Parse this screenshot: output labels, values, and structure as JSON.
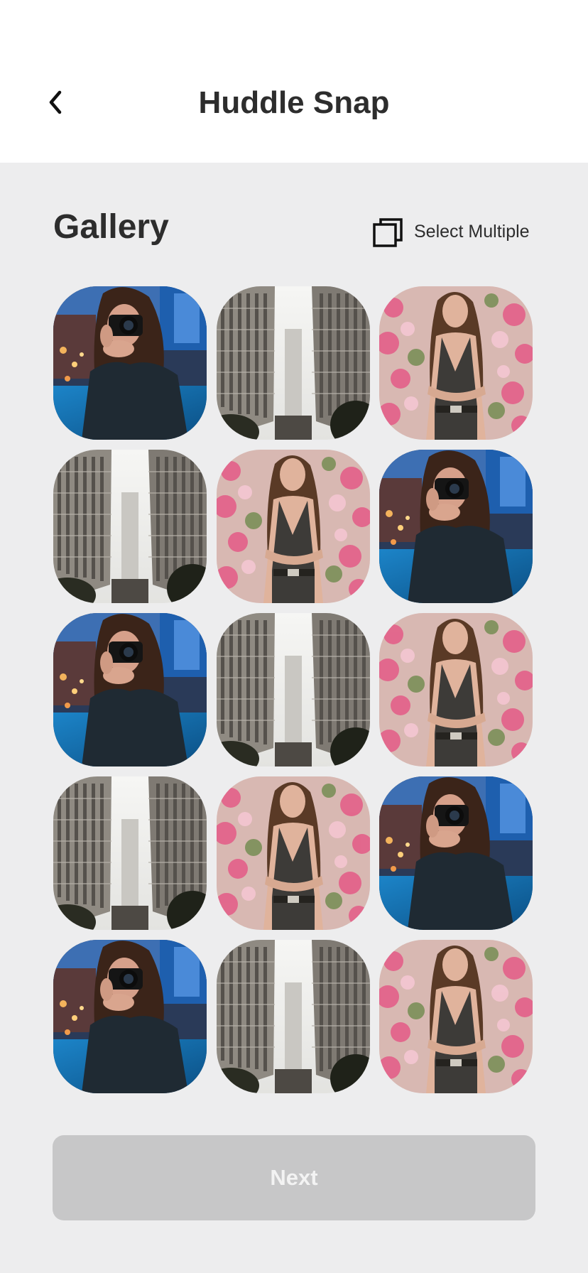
{
  "header": {
    "title": "Huddle Snap",
    "back_icon": "chevron-left-icon"
  },
  "gallery": {
    "title": "Gallery",
    "select_multiple_label": "Select Multiple",
    "select_multiple_icon": "multi-select-icon",
    "photos": [
      "camera-woman",
      "city-buildings",
      "woman-flowers",
      "city-buildings",
      "woman-flowers",
      "camera-woman",
      "camera-woman",
      "city-buildings",
      "woman-flowers",
      "city-buildings",
      "woman-flowers",
      "camera-woman",
      "camera-woman",
      "city-buildings",
      "woman-flowers"
    ]
  },
  "footer": {
    "next_label": "Next"
  },
  "colors": {
    "background": "#ededee",
    "header_background": "#ffffff",
    "text": "#2d2d2d",
    "button_disabled": "#c7c7c8",
    "button_text": "#f3f3f3"
  }
}
